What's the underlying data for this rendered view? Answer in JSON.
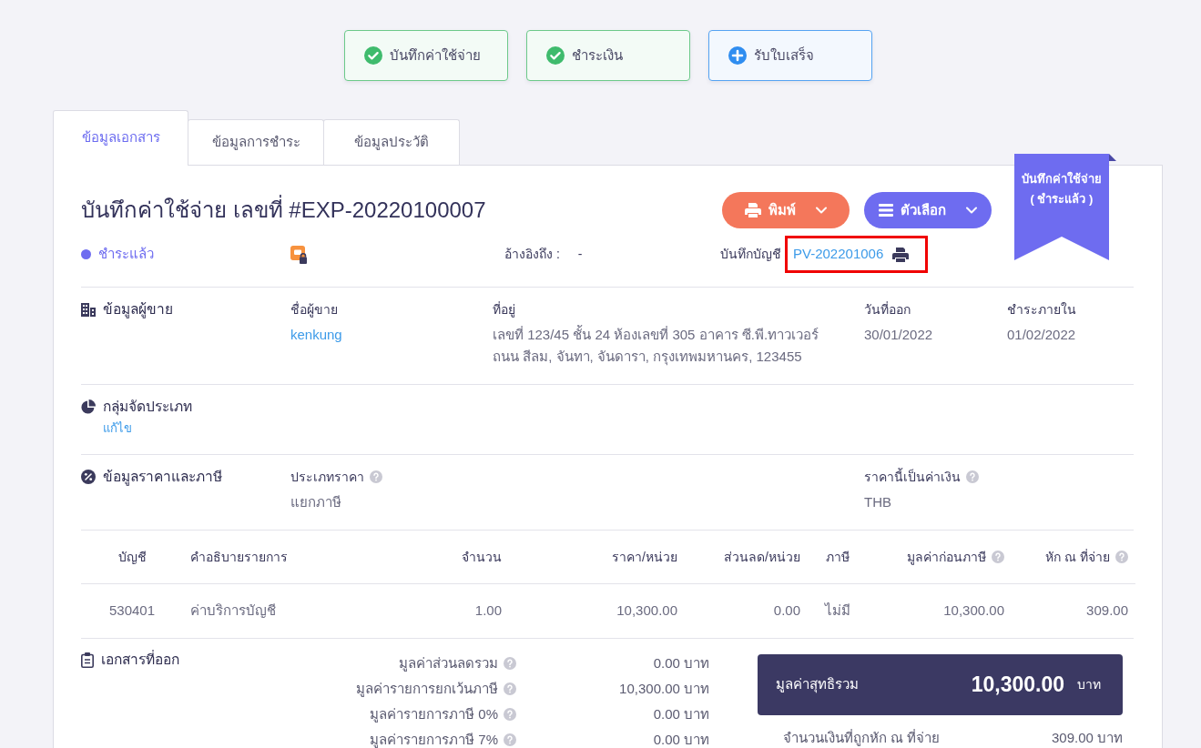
{
  "steps": [
    {
      "label": "บันทึกค่าใช้จ่าย",
      "kind": "done"
    },
    {
      "label": "ชำระเงิน",
      "kind": "done"
    },
    {
      "label": "รับใบเสร็จ",
      "kind": "pending"
    }
  ],
  "tabs": [
    {
      "label": "ข้อมูลเอกสาร",
      "selected": true
    },
    {
      "label": "ข้อมูลการชำระ",
      "selected": false
    },
    {
      "label": "ข้อมูลประวัติ",
      "selected": false
    }
  ],
  "document": {
    "title": "บันทึกค่าใช้จ่าย เลขที่ #EXP-20220100007",
    "status": "ชำระแล้ว",
    "actions": [
      {
        "label": "พิมพ์",
        "kind": "print"
      },
      {
        "label": "ตัวเลือก",
        "kind": "options"
      }
    ],
    "reference": {
      "label": "อ้างอิงถึง :",
      "value": "-"
    },
    "account_record": {
      "label": "บันทึกบัญชี",
      "value": "PV-202201006",
      "highlighted": true
    },
    "ribbon": {
      "title": "บันทึกค่าใช้จ่าย",
      "status": "( ชำระแล้ว )"
    }
  },
  "sections": [
    {
      "kind": "vendor",
      "title": "ข้อมูลผู้ขาย",
      "fields": [
        {
          "label": "ชื่อผู้ขาย",
          "kind": "link",
          "help": false,
          "lines": [
            "kenkung"
          ]
        },
        {
          "label": "ที่อยู่",
          "kind": "text",
          "help": false,
          "lines": [
            "เลขที่ 123/45 ชั้น 24 ห้องเลขที่ 305 อาคาร ซี.พี.ทาวเวอร์",
            "ถนน สีลม, จันทา, จันดารา, กรุงเทพมหานคร, 123455"
          ]
        },
        {
          "label": "วันที่ออก",
          "kind": "text",
          "help": false,
          "lines": [
            "30/01/2022"
          ]
        },
        {
          "label": "ชำระภายใน",
          "kind": "text",
          "help": false,
          "lines": [
            "01/02/2022"
          ]
        }
      ]
    },
    {
      "kind": "category",
      "title": "กลุ่มจัดประเภท",
      "action": "แก้ไข"
    },
    {
      "kind": "pricing",
      "title": "ข้อมูลราคาและภาษี",
      "fields": [
        {
          "label": "ประเภทราคา",
          "kind": "text",
          "help": true,
          "lines": [
            "แยกภาษี"
          ]
        },
        {
          "label": "ราคานี้เป็นค่าเงิน",
          "kind": "text",
          "help": true,
          "lines": [
            "THB"
          ]
        }
      ]
    }
  ],
  "items": {
    "columns": [
      {
        "label": "บัญชี",
        "help": false
      },
      {
        "label": "คำอธิบายรายการ",
        "help": false
      },
      {
        "label": "จำนวน",
        "help": false
      },
      {
        "label": "ราคา/หน่วย",
        "help": false
      },
      {
        "label": "ส่วนลด/หน่วย",
        "help": false
      },
      {
        "label": "ภาษี",
        "help": false
      },
      {
        "label": "มูลค่าก่อนภาษี",
        "help": true
      },
      {
        "label": "หัก ณ ที่จ่าย",
        "help": true
      }
    ],
    "rows": [
      [
        "530401",
        "ค่าบริการบัญชี",
        "1.00",
        "10,300.00",
        "0.00",
        "ไม่มี",
        "10,300.00",
        "309.00"
      ]
    ]
  },
  "summary": {
    "title": "เอกสารที่ออก",
    "lines": [
      {
        "label": "มูลค่าส่วนลดรวม",
        "help": true,
        "value": "0.00 บาท"
      },
      {
        "label": "มูลค่ารายการยกเว้นภาษี",
        "help": true,
        "value": "10,300.00 บาท"
      },
      {
        "label": "มูลค่ารายการภาษี 0%",
        "help": true,
        "value": "0.00 บาท"
      },
      {
        "label": "มูลค่ารายการภาษี 7%",
        "help": true,
        "value": "0.00 บาท"
      }
    ],
    "total": {
      "label": "มูลค่าสุทธิรวม",
      "amount": "10,300.00",
      "unit": "บาท"
    },
    "withholding": {
      "label": "จำนวนเงินที่ถูกหัก ณ ที่จ่าย",
      "value": "309.00 บาท"
    }
  }
}
